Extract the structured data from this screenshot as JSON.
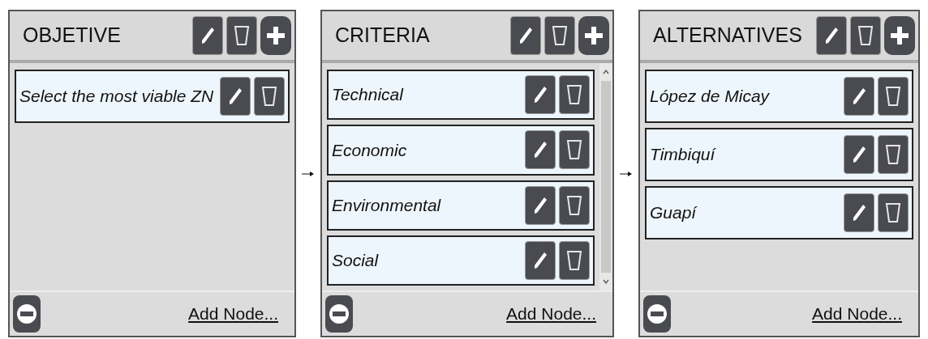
{
  "panels": [
    {
      "title": "OBJETIVE",
      "items": [
        {
          "label": "Select the most viable ZN"
        }
      ],
      "footer_link": "Add Node..."
    },
    {
      "title": "CRITERIA",
      "items": [
        {
          "label": "Technical"
        },
        {
          "label": "Economic"
        },
        {
          "label": "Environmental"
        },
        {
          "label": "Social"
        }
      ],
      "footer_link": "Add Node..."
    },
    {
      "title": "ALTERNATIVES",
      "items": [
        {
          "label": "López de Micay"
        },
        {
          "label": "Timbiquí"
        },
        {
          "label": "Guapí"
        }
      ],
      "footer_link": "Add Node..."
    }
  ]
}
